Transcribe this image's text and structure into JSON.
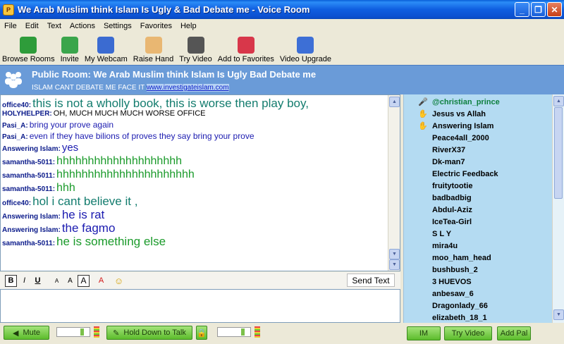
{
  "window": {
    "title": "We Arab Muslim think Islam Is Ugly & Bad Debate me - Voice Room",
    "minimize": "_",
    "maximize": "❐",
    "close": "✕"
  },
  "menu": [
    "File",
    "Edit",
    "Text",
    "Actions",
    "Settings",
    "Favorites",
    "Help"
  ],
  "toolbar": [
    {
      "label": "Browse Rooms",
      "icon": "people-icon",
      "color": "#2e9c3a"
    },
    {
      "label": "Invite",
      "icon": "invite-icon",
      "color": "#3aa54b"
    },
    {
      "label": "My Webcam",
      "icon": "webcam-icon",
      "color": "#3b6bd1"
    },
    {
      "label": "Raise Hand",
      "icon": "hand-icon",
      "color": "#e9b772"
    },
    {
      "label": "Try Video",
      "icon": "video-camera-icon",
      "color": "#555555"
    },
    {
      "label": "Add to Favorites",
      "icon": "add-favorite-icon",
      "color": "#d8374a"
    },
    {
      "label": "Video Upgrade",
      "icon": "video-upgrade-icon",
      "color": "#3d6fd6"
    }
  ],
  "room": {
    "title": "Public Room: We Arab Muslim think Islam Is Ugly  Bad Debate me",
    "subtitle": "ISLAM CANT DEBATE ME FACE IT",
    "link": "www.investigateislam.com"
  },
  "messages": [
    {
      "user": "office40:",
      "text": "this is not a wholly book, this is worse then play boy,",
      "color": "#137c6e",
      "size": 17
    },
    {
      "user": "HOLYHELPER:",
      "text": "OH, MUCH MUCH MUCH WORSE OFFICE",
      "color": "#000000",
      "size": 11
    },
    {
      "user": "Pasi_A:",
      "text": "bring your prove again",
      "color": "#1b1bb0",
      "size": 12
    },
    {
      "user": "Pasi_A:",
      "text": "even if they have bilions of proves they say bring your prove",
      "color": "#1b1bb0",
      "size": 12
    },
    {
      "user": "Answering Islam:",
      "text": "yes",
      "color": "#1b1bb0",
      "size": 15
    },
    {
      "user": "samantha-5011:",
      "text": "hhhhhhhhhhhhhhhhhhhh",
      "color": "#1a9a2a",
      "size": 16
    },
    {
      "user": "samantha-5011:",
      "text": "hhhhhhhhhhhhhhhhhhhhhh",
      "color": "#1a9a2a",
      "size": 16
    },
    {
      "user": "samantha-5011:",
      "text": "hhh",
      "color": "#1a9a2a",
      "size": 16
    },
    {
      "user": "office40:",
      "text": "hol i cant believe it  ,",
      "color": "#137c6e",
      "size": 17
    },
    {
      "user": "Answering Islam:",
      "text": "he is rat",
      "color": "#1b1bb0",
      "size": 17
    },
    {
      "user": "Answering Islam:",
      "text": "the fagmo",
      "color": "#1b1bb0",
      "size": 17
    },
    {
      "user": "samantha-5011:",
      "text": "he  is something else",
      "color": "#1a9a2a",
      "size": 17
    }
  ],
  "format": {
    "bold": "B",
    "italic": "I",
    "underline": "U",
    "font_small": "A",
    "font_medium": "A",
    "font_large": "A",
    "color": "A",
    "emoticon": "☺",
    "send": "Send Text"
  },
  "users": [
    {
      "name": "@christian_prince",
      "icon": "microphone-icon",
      "glyph": "🎤",
      "state": "mic"
    },
    {
      "name": "Jesus vs Allah",
      "icon": "raised-hand-icon",
      "glyph": "✋",
      "state": "hand"
    },
    {
      "name": "Answering Islam",
      "icon": "raised-hand-icon",
      "glyph": "✋",
      "state": "hand"
    },
    {
      "name": "Peace4all_2000",
      "icon": "",
      "glyph": "",
      "state": ""
    },
    {
      "name": "RiverX37",
      "icon": "",
      "glyph": "",
      "state": ""
    },
    {
      "name": "Dk-man7",
      "icon": "",
      "glyph": "",
      "state": ""
    },
    {
      "name": "Electric Feedback",
      "icon": "",
      "glyph": "",
      "state": ""
    },
    {
      "name": "fruitytootie",
      "icon": "",
      "glyph": "",
      "state": ""
    },
    {
      "name": "badbadbig",
      "icon": "",
      "glyph": "",
      "state": ""
    },
    {
      "name": "Abdul-Aziz",
      "icon": "",
      "glyph": "",
      "state": ""
    },
    {
      "name": "IceTea-Girl",
      "icon": "",
      "glyph": "",
      "state": ""
    },
    {
      "name": "S L Y",
      "icon": "",
      "glyph": "",
      "state": ""
    },
    {
      "name": "mira4u",
      "icon": "",
      "glyph": "",
      "state": ""
    },
    {
      "name": "moo_ham_head",
      "icon": "",
      "glyph": "",
      "state": ""
    },
    {
      "name": "bushbush_2",
      "icon": "",
      "glyph": "",
      "state": ""
    },
    {
      "name": "3 HUEVOS",
      "icon": "",
      "glyph": "",
      "state": ""
    },
    {
      "name": "anbesaw_6",
      "icon": "",
      "glyph": "",
      "state": ""
    },
    {
      "name": "Dragonlady_66",
      "icon": "",
      "glyph": "",
      "state": ""
    },
    {
      "name": "elizabeth_18_1",
      "icon": "",
      "glyph": "",
      "state": ""
    }
  ],
  "bottom": {
    "mute": "Mute",
    "hold_to_talk": "Hold Down to Talk",
    "im": "IM",
    "try_video": "Try Video",
    "add_pal": "Add Pal"
  }
}
